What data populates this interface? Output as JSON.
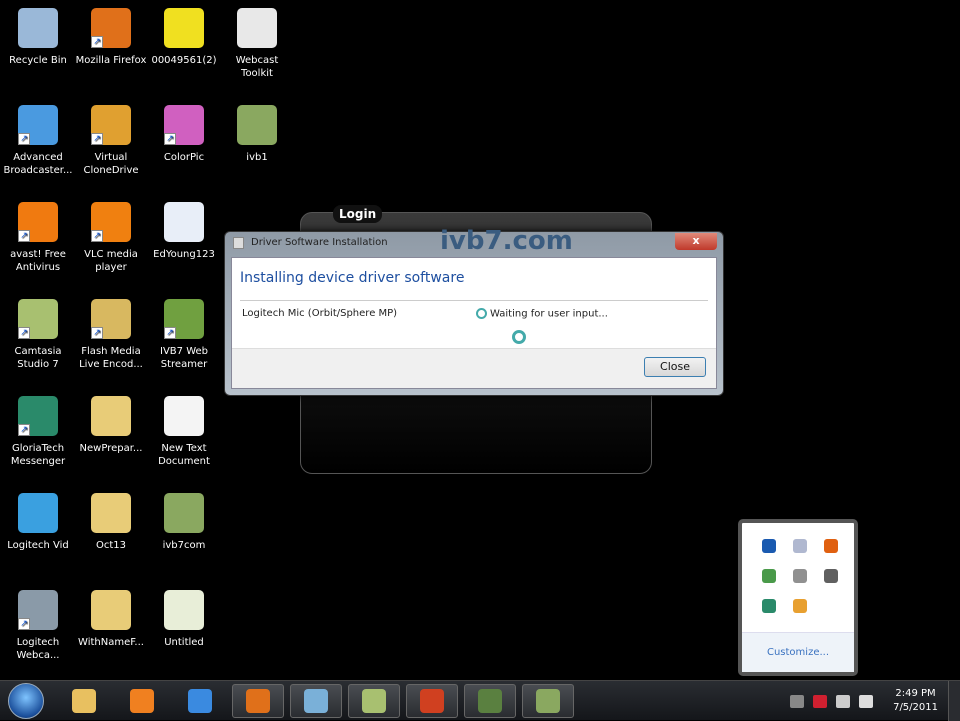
{
  "desktop_icons": [
    {
      "label": "Recycle Bin",
      "color": "#9ab8d8",
      "shortcut": false
    },
    {
      "label": "Advanced Broadcaster...",
      "color": "#4a9ae0",
      "shortcut": true
    },
    {
      "label": "avast! Free Antivirus",
      "color": "#f07a10",
      "shortcut": true
    },
    {
      "label": "Camtasia Studio 7",
      "color": "#a8c070",
      "shortcut": true
    },
    {
      "label": "GloriaTech Messenger",
      "color": "#2a8a6a",
      "shortcut": true
    },
    {
      "label": "Logitech Vid",
      "color": "#3aa0e0",
      "shortcut": false
    },
    {
      "label": "Logitech Webca...",
      "color": "#8a9aa8",
      "shortcut": true
    },
    {
      "label": "Mozilla Firefox",
      "color": "#e0701a",
      "shortcut": true
    },
    {
      "label": "Virtual CloneDrive",
      "color": "#e0a030",
      "shortcut": true
    },
    {
      "label": "VLC media player",
      "color": "#f08010",
      "shortcut": true
    },
    {
      "label": "Flash Media Live Encod...",
      "color": "#d8b860",
      "shortcut": true
    },
    {
      "label": "NewPrepar...",
      "color": "#e8cc78",
      "shortcut": false
    },
    {
      "label": "Oct13",
      "color": "#e8cc78",
      "shortcut": false
    },
    {
      "label": "WithNameF...",
      "color": "#e8cc78",
      "shortcut": false
    },
    {
      "label": "00049561(2)",
      "color": "#f0e020",
      "shortcut": false
    },
    {
      "label": "ColorPic",
      "color": "#d060c0",
      "shortcut": true
    },
    {
      "label": "EdYoung123",
      "color": "#e8eef8",
      "shortcut": false
    },
    {
      "label": "IVB7 Web Streamer",
      "color": "#70a040",
      "shortcut": true
    },
    {
      "label": "New Text Document",
      "color": "#f4f4f4",
      "shortcut": false
    },
    {
      "label": "ivb7com",
      "color": "#8aa860",
      "shortcut": false
    },
    {
      "label": "Untitled",
      "color": "#e8eed8",
      "shortcut": false
    },
    {
      "label": "Webcast Toolkit",
      "color": "#e8e8e8",
      "shortcut": false
    },
    {
      "label": "ivb1",
      "color": "#8aa860",
      "shortcut": false
    }
  ],
  "login": {
    "label": "Login",
    "watermark": "ivb7.com"
  },
  "dialog": {
    "title": "Driver Software Installation",
    "close_x": "x",
    "heading": "Installing device driver software",
    "device": "Logitech Mic (Orbit/Sphere MP)",
    "status": "Waiting for user input...",
    "close_button": "Close"
  },
  "tray_popup": {
    "icons": [
      {
        "color": "#1a5ab0"
      },
      {
        "color": "#b0b8d0"
      },
      {
        "color": "#e06010"
      },
      {
        "color": "#4a9a4a"
      },
      {
        "color": "#909090"
      },
      {
        "color": "#606060"
      },
      {
        "color": "#2a8a6a"
      },
      {
        "color": "#e8a030"
      }
    ],
    "customize": "Customize..."
  },
  "taskbar": {
    "pinned": [
      {
        "name": "windows-explorer",
        "color": "#e8c060"
      },
      {
        "name": "media-player",
        "color": "#f08020"
      },
      {
        "name": "internet-explorer",
        "color": "#3a8ae0"
      }
    ],
    "running": [
      {
        "name": "firefox",
        "color": "#e0701a"
      },
      {
        "name": "window",
        "color": "#7ab0d8"
      },
      {
        "name": "camtasia",
        "color": "#a8c070"
      },
      {
        "name": "powerpoint",
        "color": "#d04020"
      },
      {
        "name": "streamer",
        "color": "#5a8040"
      },
      {
        "name": "video",
        "color": "#8aa860"
      }
    ],
    "tray_icons": [
      {
        "color": "#888"
      },
      {
        "color": "#d02030"
      },
      {
        "color": "#ccc"
      },
      {
        "color": "#ddd"
      }
    ],
    "time": "2:49 PM",
    "date": "7/5/2011"
  }
}
